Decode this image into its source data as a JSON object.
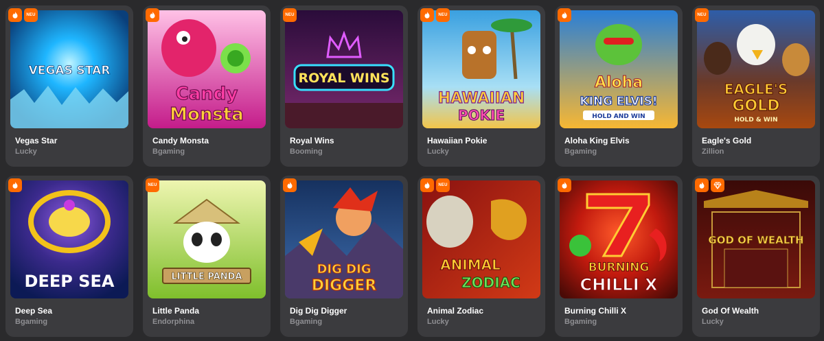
{
  "badges": {
    "new_label": "NEU"
  },
  "games": [
    {
      "name": "Vegas Star",
      "provider": "Lucky",
      "badges": [
        "hot",
        "new"
      ],
      "art_text": [
        "VEGAS STAR"
      ],
      "colors": [
        "#0a3f7a",
        "#1fb6ff"
      ]
    },
    {
      "name": "Candy Monsta",
      "provider": "Bgaming",
      "badges": [
        "hot"
      ],
      "art_text": [
        "Candy",
        "Monsta"
      ],
      "colors": [
        "#ff6fb5",
        "#c41c8a"
      ]
    },
    {
      "name": "Royal Wins",
      "provider": "Booming",
      "badges": [
        "new"
      ],
      "art_text": [
        "ROYAL WINS"
      ],
      "colors": [
        "#2a0c3a",
        "#7a2a6e"
      ]
    },
    {
      "name": "Hawaiian Pokie",
      "provider": "Lucky",
      "badges": [
        "hot",
        "new"
      ],
      "art_text": [
        "HAWAIIAN",
        "POKIE"
      ],
      "colors": [
        "#3aa0e0",
        "#f2c54a"
      ]
    },
    {
      "name": "Aloha King Elvis",
      "provider": "Bgaming",
      "badges": [
        "hot"
      ],
      "art_text": [
        "Aloha",
        "KING ELVIS!",
        "HOLD AND WIN"
      ],
      "colors": [
        "#f7b733",
        "#1f6fd6"
      ]
    },
    {
      "name": "Eagle's Gold",
      "provider": "Zillion",
      "badges": [
        "new"
      ],
      "art_text": [
        "EAGLE'S",
        "GOLD",
        "HOLD & WIN"
      ],
      "colors": [
        "#2e5da8",
        "#a8480f"
      ]
    },
    {
      "name": "Deep Sea",
      "provider": "Bgaming",
      "badges": [
        "hot"
      ],
      "art_text": [
        "DEEP SEA"
      ],
      "colors": [
        "#3b2a8c",
        "#0c1a55"
      ]
    },
    {
      "name": "Little Panda",
      "provider": "Endorphina",
      "badges": [
        "new"
      ],
      "art_text": [
        "LITTLE PANDA"
      ],
      "colors": [
        "#d8e78a",
        "#7fbf2c"
      ]
    },
    {
      "name": "Dig Dig Digger",
      "provider": "Bgaming",
      "badges": [
        "hot"
      ],
      "art_text": [
        "DIG DIG",
        "DIGGER"
      ],
      "colors": [
        "#16315f",
        "#3f6fb0"
      ]
    },
    {
      "name": "Animal Zodiac",
      "provider": "Lucky",
      "badges": [
        "hot",
        "new"
      ],
      "art_text": [
        "ANIMAL",
        "ZODIAC"
      ],
      "colors": [
        "#8a1210",
        "#d23a16"
      ]
    },
    {
      "name": "Burning Chilli X",
      "provider": "Bgaming",
      "badges": [
        "hot"
      ],
      "art_text": [
        "BURNING",
        "CHILLI X"
      ],
      "colors": [
        "#4a0a06",
        "#c21a0e"
      ]
    },
    {
      "name": "God Of Wealth",
      "provider": "Lucky",
      "badges": [
        "hot",
        "gem"
      ],
      "art_text": [
        "GOD OF WEALTH"
      ],
      "colors": [
        "#3a0a08",
        "#7a1a10"
      ]
    }
  ]
}
